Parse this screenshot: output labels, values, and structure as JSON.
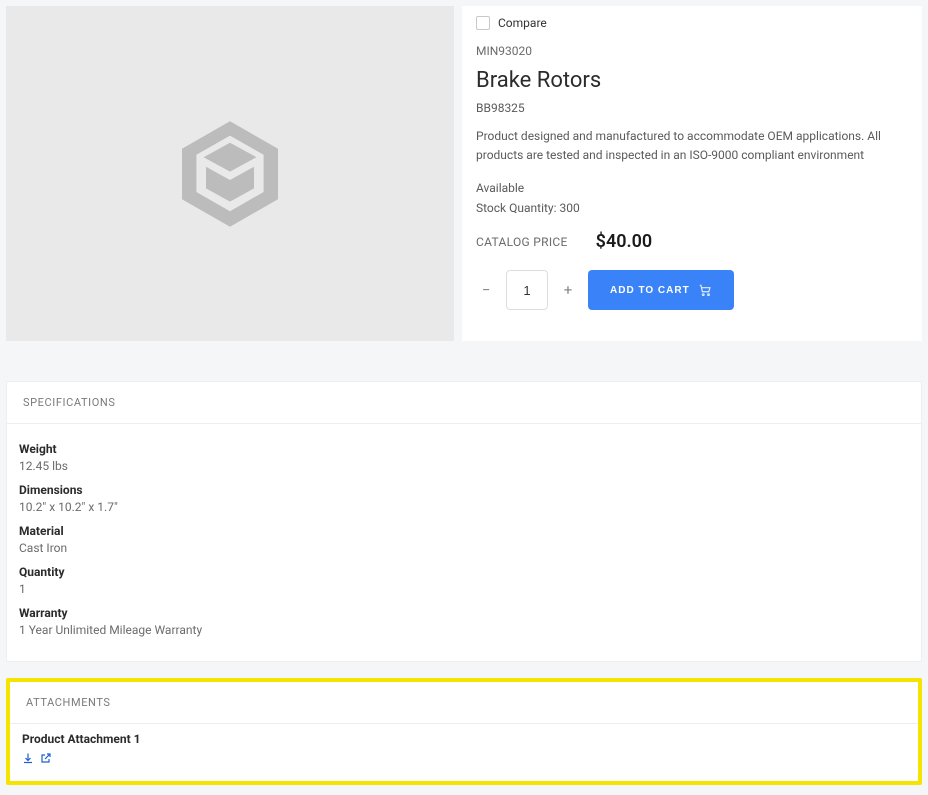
{
  "product": {
    "compare_label": "Compare",
    "sku": "MIN93020",
    "title": "Brake Rotors",
    "model": "BB98325",
    "description": "Product designed and manufactured to accommodate OEM applications. All products are tested and inspected in an ISO-9000 compliant environment",
    "availability": "Available",
    "stock_line": "Stock Quantity: 300",
    "price_label": "CATALOG PRICE",
    "price": "$40.00",
    "qty": "1",
    "add_to_cart_label": "ADD TO CART"
  },
  "specifications": {
    "heading": "SPECIFICATIONS",
    "items": [
      {
        "label": "Weight",
        "value": "12.45 lbs"
      },
      {
        "label": "Dimensions",
        "value": "10.2\" x 10.2\" x 1.7\""
      },
      {
        "label": "Material",
        "value": "Cast Iron"
      },
      {
        "label": "Quantity",
        "value": "1"
      },
      {
        "label": "Warranty",
        "value": "1 Year Unlimited Mileage Warranty"
      }
    ]
  },
  "attachments": {
    "heading": "ATTACHMENTS",
    "items": [
      {
        "title": "Product Attachment 1"
      }
    ]
  }
}
